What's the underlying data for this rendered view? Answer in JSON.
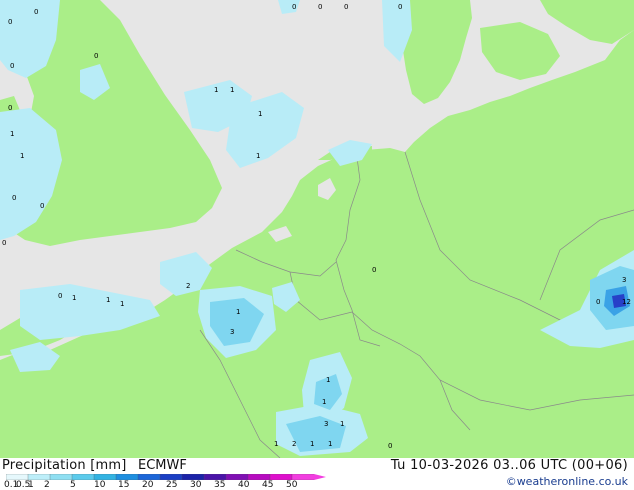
{
  "footer": {
    "title": "Precipitation [mm]",
    "model": "ECMWF",
    "validity": "Tu 10-03-2026 03..06 UTC (00+06)",
    "credit": "©weatheronline.co.uk"
  },
  "legend": {
    "ticks": [
      "0.1",
      "0.5",
      "1",
      "2",
      "5",
      "10",
      "15",
      "20",
      "25",
      "30",
      "35",
      "40",
      "45",
      "50"
    ],
    "colors": [
      "#e6f8fc",
      "#bdeef9",
      "#8fdff2",
      "#5ccbec",
      "#33b3e2",
      "#1f8fe0",
      "#1c66d8",
      "#1b3fc4",
      "#1b23a8",
      "#4a14a8",
      "#8010b4",
      "#b70cc0",
      "#de10cc",
      "#f23ee0"
    ]
  },
  "map_colors": {
    "sea": "#e6e6e6",
    "land": "#aaee88",
    "precip_light": "#b8ecf7",
    "precip_medium": "#7fd6f0",
    "precip_heavy": "#3aa2e6",
    "precip_max": "#2740c8"
  },
  "map_values": [
    "0",
    "0",
    "0",
    "0",
    "0",
    "0",
    "0",
    "0",
    "0",
    "0",
    "0",
    "0",
    "1",
    "1",
    "1",
    "1",
    "1",
    "2",
    "3",
    "1",
    "3",
    "12",
    "0",
    "0",
    "1",
    "1",
    "1",
    "1",
    "1",
    "1",
    "0",
    "1",
    "2",
    "1",
    "1",
    "3",
    "1",
    "0"
  ]
}
